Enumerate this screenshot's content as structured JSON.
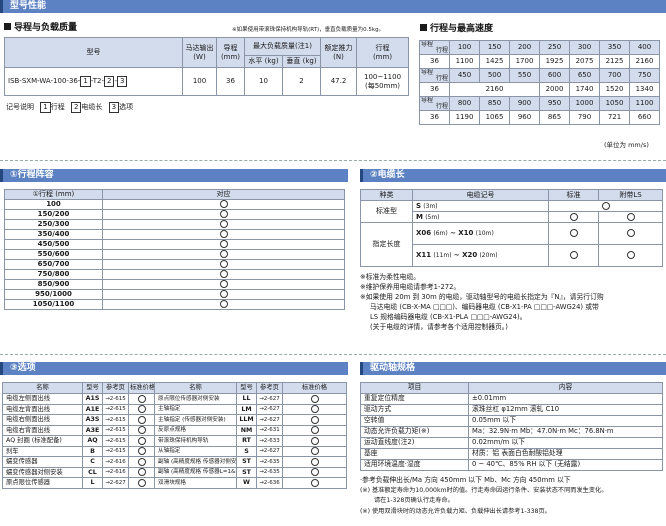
{
  "header": {
    "title": "型号性能"
  },
  "model_table": {
    "title": "导程与负载质量",
    "note": "※如果使用带滚珠保持机构导轨(RT)，垂直负载质量为0.5kg。",
    "headers": {
      "model": "型号",
      "motor": "马达输出\n(W)",
      "lead": "导程\n(mm)",
      "max_load": "最大负载质量(注1)",
      "horizontal": "水平 (kg)",
      "vertical": "垂直 (kg)",
      "thrust": "额定推力\n(N)",
      "stroke": "行程\n(mm)"
    },
    "row": {
      "model_prefix": "ISB-SXM-WA-100-36-",
      "b1": "1",
      "mid": "-T2-",
      "b2": "2",
      "dash": "-",
      "b3": "3",
      "motor": "100",
      "lead": "36",
      "horizontal": "10",
      "vertical": "2",
      "thrust": "47.2",
      "stroke": "100~1100\n(每50mm)"
    },
    "legend": {
      "label": "记号说明",
      "i1": "1",
      "t1": "行程",
      "i2": "2",
      "t2": "电缆长",
      "i3": "3",
      "t3": "选项"
    }
  },
  "speed_table": {
    "title": "行程与最高速度",
    "lead_label": "导程",
    "stroke_label": "行程",
    "blocks": [
      {
        "strokes": [
          "100",
          "150",
          "200",
          "250",
          "300",
          "350",
          "400"
        ],
        "lead": "36",
        "speeds": [
          "1100",
          "1425",
          "1700",
          "1925",
          "2075",
          "2125",
          "2160"
        ]
      },
      {
        "strokes": [
          "450",
          "500",
          "550",
          "600",
          "650",
          "700",
          "750"
        ],
        "lead": "36",
        "speeds": [
          "2160",
          "2000",
          "1740",
          "1520",
          "1340"
        ]
      },
      {
        "strokes": [
          "800",
          "850",
          "900",
          "950",
          "1000",
          "1050",
          "1100"
        ],
        "lead": "36",
        "speeds": [
          "1190",
          "1065",
          "960",
          "865",
          "790",
          "721",
          "660"
        ]
      }
    ],
    "unit": "(单位为 mm/s)"
  },
  "stroke_section": {
    "title": "①行程阵容",
    "headers": [
      "①行程 (mm)",
      "对应"
    ],
    "rows": [
      "100",
      "150/200",
      "250/300",
      "350/400",
      "450/500",
      "550/600",
      "650/700",
      "750/800",
      "850/900",
      "950/1000",
      "1050/1100"
    ]
  },
  "cable_section": {
    "title": "②电缆长",
    "headers": [
      "种类",
      "电缆记号",
      "标准",
      "附带LS"
    ],
    "standard_type": "标准型",
    "designated": "指定长度",
    "s_code": "S",
    "s_len": "(3m)",
    "m_code": "M",
    "m_len": "(5m)",
    "x06": "X06",
    "x06_len": "(6m)",
    "x10": "~ X10",
    "x10_len": "(10m)",
    "x11": "X11",
    "x11_len": "(11m)",
    "x20": "~ X20",
    "x20_len": "(20m)",
    "notes": [
      "※标准为柔性电缆。",
      "※维护保养用电缆请参考1-272。",
      "※如果使用 20m 到 30m 的电缆，驱动轴型号的电缆长指定为『N』，请另行订购",
      "马达电缆 (CB-X-MA □□□)、编码器电缆 (CB-X1-PA □□□-AWG24) 或带",
      "LS 规格编码器电缆 (CB-X1-PLA □□□-AWG24)。",
      "(关于电缆的详情，请参考各个适用控制器页。)"
    ]
  },
  "options_section": {
    "title": "③选项",
    "headers": [
      "名称",
      "型号",
      "参考页",
      "标准价格"
    ],
    "left": [
      {
        "name": "电缆左侧面出线",
        "code": "A1S",
        "page": "→2-615"
      },
      {
        "name": "电缆左背面出线",
        "code": "A1E",
        "page": "→2-615"
      },
      {
        "name": "电缆右侧面出线",
        "code": "A3S",
        "page": "→2-615"
      },
      {
        "name": "电缆右背面出线",
        "code": "A3E",
        "page": "→2-615"
      },
      {
        "name": "AQ 封圈 (标准配备)",
        "code": "AQ",
        "page": "→2-615"
      },
      {
        "name": "刹车",
        "code": "B",
        "page": "→2-615"
      },
      {
        "name": "蠕变传感器",
        "code": "C",
        "page": "→2-616"
      },
      {
        "name": "蠕变传感器对侧安装",
        "code": "CL",
        "page": "→2-616"
      },
      {
        "name": "原点限位传感器",
        "code": "L",
        "page": "→2-627"
      }
    ],
    "right": [
      {
        "name": "原点限位传感器对侧安装",
        "code": "LL",
        "page": "→2-627"
      },
      {
        "name": "主轴指定",
        "code": "LM",
        "page": "→2-627"
      },
      {
        "name": "主轴指定 (传感器对侧安装)",
        "code": "LLM",
        "page": "→2-627"
      },
      {
        "name": "反原点规格",
        "code": "NM",
        "page": "→2-631"
      },
      {
        "name": "带滚珠保持机构导轨",
        "code": "RT",
        "page": "→2-633"
      },
      {
        "name": "从轴指定",
        "code": "S",
        "page": "→2-627"
      },
      {
        "name": "副轴 (高精度规格 传感器对侧安装)",
        "code": "ST",
        "page": "→2-635"
      },
      {
        "name": "副轴 (高精度规格 传感器L=1&RZ)",
        "code": "ST",
        "page": "→2-635"
      },
      {
        "name": "双滑块规格",
        "code": "W",
        "page": "→2-636"
      }
    ]
  },
  "drive_section": {
    "title": "驱动轴规格",
    "headers": [
      "项目",
      "内容"
    ],
    "rows": [
      [
        "重复定位精度",
        "±0.01mm"
      ],
      [
        "驱动方式",
        "滚珠丝杠 φ12mm  滚轧 C10"
      ],
      [
        "空转值",
        "0.05mm 以下"
      ],
      [
        "动态允许负载力矩(※)",
        "Ma：32.9N·m   Mb：47.0N·m   Mc：76.8N·m"
      ],
      [
        "运动直线度(注2)",
        "0.02mm/m 以下"
      ],
      [
        "基座",
        "材质：铝   表面白色耐酸铝处理"
      ],
      [
        "适用环境温度·湿度",
        "0 ~ 40℃、85% RH 以下 (无结露)"
      ]
    ],
    "notes": [
      "·参考负载伸出长/Ma 方向 450mm 以下   Mb、Mc 方向 450mm 以下",
      "(※) 基准额定寿命为10,000km时的值。行走寿命因运行条件、安装状态不同而发生变化。",
      "请在1-328页确认行走寿命。",
      "(※) 使用双滑块时的动态允许负载力矩、负载伸出长请参考1-338页。"
    ]
  }
}
